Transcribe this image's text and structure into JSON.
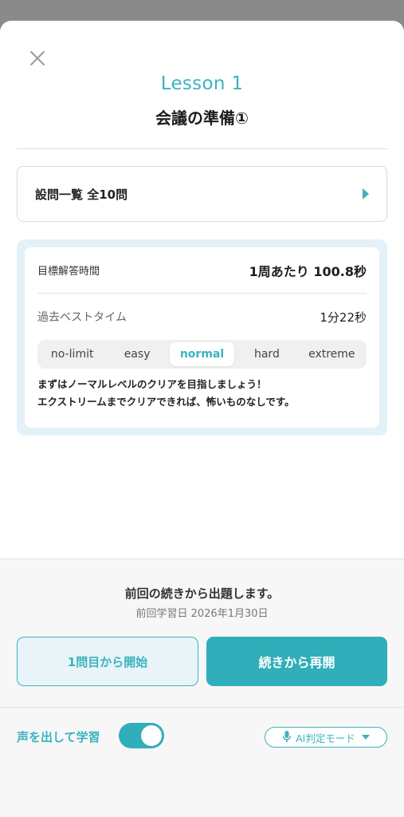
{
  "header": {
    "lesson_label": "Lesson 1",
    "lesson_title": "会議の準備①"
  },
  "question_list": {
    "label": "設問一覧 全10問"
  },
  "goal": {
    "target_label": "目標解答時間",
    "target_value": "1周あたり 100.8秒",
    "best_label": "過去ベストタイム",
    "best_value": "1分22秒",
    "levels": [
      "no-limit",
      "easy",
      "normal",
      "hard",
      "extreme"
    ],
    "selected_level": "normal",
    "description_line1": "まずはノーマルレベルのクリアを目指しましょう！",
    "description_line2": "エクストリームまでクリアできれば、怖いものなしです。"
  },
  "footer": {
    "resume_message": "前回の続きから出題します。",
    "last_study_date": "前回学習日 2026年1月30日",
    "restart_button": "1問目から開始",
    "continue_button": "続きから再開",
    "voice_label": "声を出して学習",
    "voice_toggle_on": true,
    "ai_mode_label": "AI判定モード"
  },
  "icons": {
    "close": "close-icon",
    "arrow": "arrow-right-icon",
    "mic": "microphone-icon",
    "caret": "caret-down-icon"
  },
  "colors": {
    "accent": "#3bb3bf",
    "button_primary": "#30aeb9",
    "panel_bg": "#e4f2f7"
  }
}
